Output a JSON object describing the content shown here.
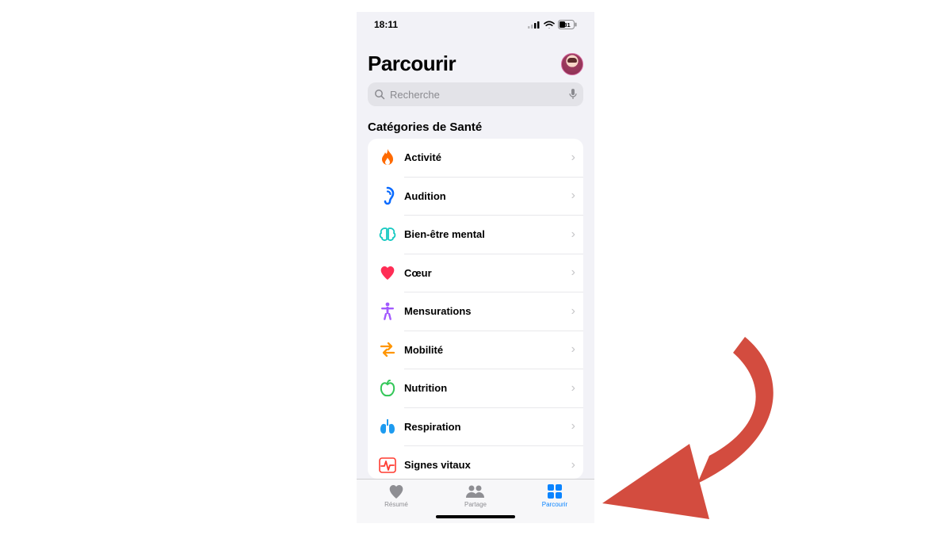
{
  "status": {
    "time": "18:11",
    "battery": "31"
  },
  "header": {
    "title": "Parcourir"
  },
  "search": {
    "placeholder": "Recherche"
  },
  "section": {
    "title": "Catégories de Santé",
    "items": [
      {
        "label": "Activité",
        "icon": "flame-icon",
        "color": "#ff6a00"
      },
      {
        "label": "Audition",
        "icon": "ear-icon",
        "color": "#0a6bff"
      },
      {
        "label": "Bien-être mental",
        "icon": "brain-icon",
        "color": "#14c9c1"
      },
      {
        "label": "Cœur",
        "icon": "heart-icon",
        "color": "#ff2d55"
      },
      {
        "label": "Mensurations",
        "icon": "body-icon",
        "color": "#a259ff"
      },
      {
        "label": "Mobilité",
        "icon": "arrows-icon",
        "color": "#ff9500"
      },
      {
        "label": "Nutrition",
        "icon": "apple-icon",
        "color": "#34c759"
      },
      {
        "label": "Respiration",
        "icon": "lungs-icon",
        "color": "#1d9bf0"
      },
      {
        "label": "Signes vitaux",
        "icon": "vitals-icon",
        "color": "#ff3b30"
      }
    ]
  },
  "tabs": [
    {
      "label": "Résumé",
      "icon": "heart-tab-icon",
      "active": false
    },
    {
      "label": "Partage",
      "icon": "people-tab-icon",
      "active": false
    },
    {
      "label": "Parcourir",
      "icon": "grid-tab-icon",
      "active": true
    }
  ]
}
